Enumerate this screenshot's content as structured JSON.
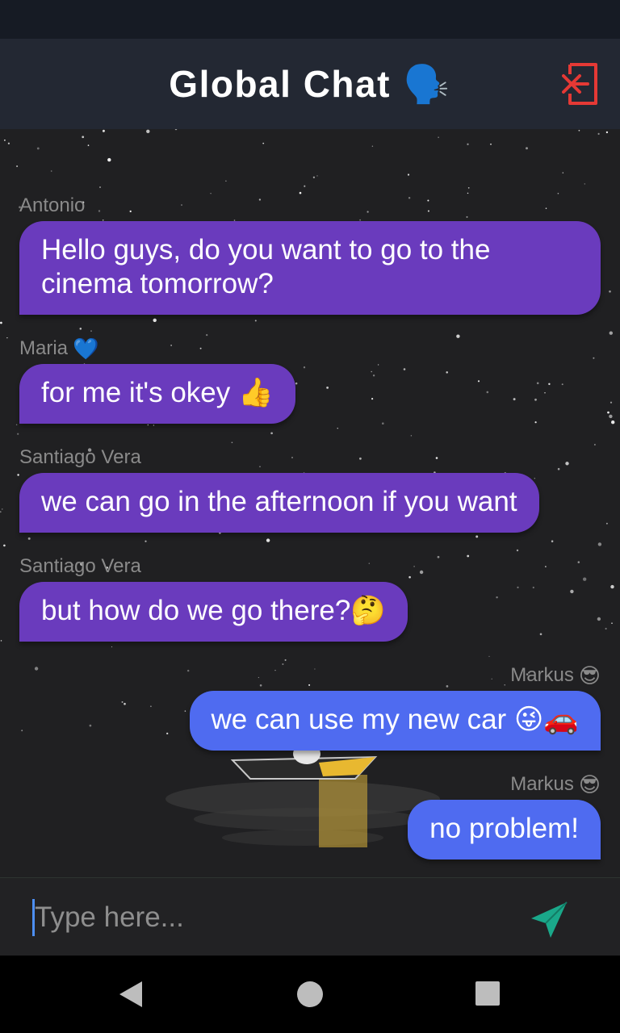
{
  "header": {
    "title": "Global Chat",
    "title_emoji": "🗣️",
    "exit_icon": "logout-icon"
  },
  "messages": [
    {
      "sender": "Antonio",
      "sender_emoji": "",
      "text": "Hello guys, do you want to go to the cinema tomorrow?",
      "side": "left"
    },
    {
      "sender": "Maria",
      "sender_emoji": "💙",
      "text": "for me it's okey 👍",
      "side": "left"
    },
    {
      "sender": "Santiago Vera",
      "sender_emoji": "",
      "text": "we can go in the afternoon if you want",
      "side": "left"
    },
    {
      "sender": "Santiago Vera",
      "sender_emoji": "",
      "text": "but how do we go there?🤔",
      "side": "left"
    },
    {
      "sender": "Markus",
      "sender_emoji": "😎",
      "text": "we can use my new car 😜🚗",
      "side": "right"
    },
    {
      "sender": "Markus",
      "sender_emoji": "😎",
      "text": "no problem!",
      "side": "right"
    }
  ],
  "input": {
    "placeholder": "Type here...",
    "value": ""
  },
  "colors": {
    "others_bubble": "#6a3bbd",
    "own_bubble": "#4f6bf0",
    "send_icon": "#1aa88a",
    "exit_icon": "#e53935",
    "app_bar": "#232833"
  },
  "icons": {
    "send": "send-icon",
    "nav_back": "back-triangle-icon",
    "nav_home": "home-circle-icon",
    "nav_recent": "recents-square-icon"
  }
}
